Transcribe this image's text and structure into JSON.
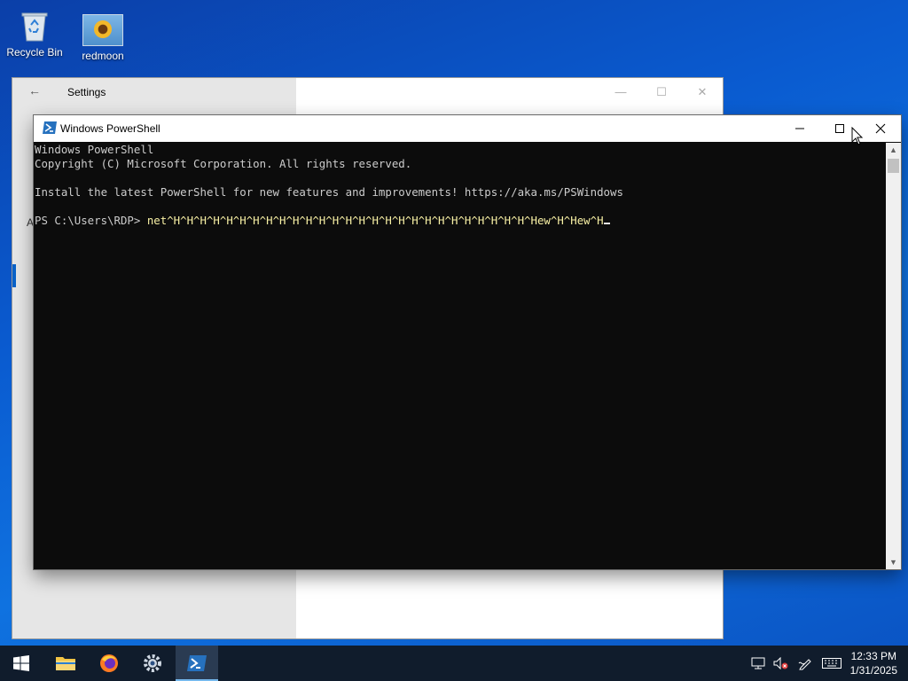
{
  "desktop": {
    "icons": [
      {
        "label": "Recycle Bin"
      },
      {
        "label": "redmoon"
      }
    ]
  },
  "settings_window": {
    "title": "Settings",
    "partial_letters": {
      "a": "A"
    }
  },
  "powershell": {
    "title": "Windows PowerShell",
    "lines": [
      "Windows PowerShell",
      "Copyright (C) Microsoft Corporation. All rights reserved.",
      "",
      "Install the latest PowerShell for new features and improvements! https://aka.ms/PSWindows",
      ""
    ],
    "prompt": "PS C:\\Users\\RDP> ",
    "command": "net^H^H^H^H^H^H^H^H^H^H^H^H^H^H^H^H^H^H^H^H^H^H^H^H^H^H^H^Hew^H^Hew^H"
  },
  "taskbar": {
    "apps": [
      {
        "name": "start",
        "icon": "windows-logo-icon"
      },
      {
        "name": "file-explorer",
        "icon": "folder-icon"
      },
      {
        "name": "firefox",
        "icon": "firefox-icon"
      },
      {
        "name": "settings",
        "icon": "gear-icon"
      },
      {
        "name": "powershell",
        "icon": "powershell-icon",
        "active": true
      }
    ],
    "time": "12:33 PM",
    "date": "1/31/2025"
  },
  "colors": {
    "console_bg": "#0c0c0c",
    "console_fg": "#cccccc",
    "command_fg": "#f9f1a5",
    "taskbar_bg": "#101c2c",
    "accent": "#76b9ed"
  }
}
